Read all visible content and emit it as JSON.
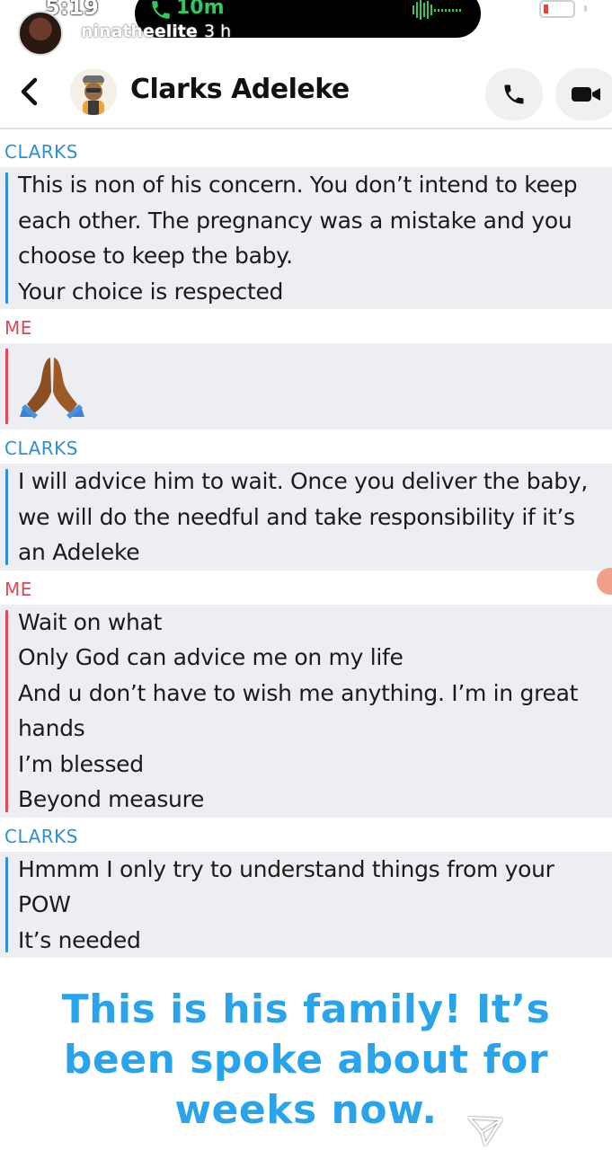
{
  "status_bar": {
    "time": "5:19",
    "call_duration": "10m",
    "call_color": "#34c759"
  },
  "story": {
    "username": "ninatheelite",
    "age": "3 h"
  },
  "chat": {
    "contact_name": "Clarks Adeleke",
    "contact_color": "#2d8fd8",
    "me_color": "#e0485a"
  },
  "messages": [
    {
      "sender": "CLARKS",
      "from": "them",
      "lines": [
        "This is non of his concern. You don’t intend to keep",
        "each other. The pregnancy was a mistake and you",
        "choose to keep the baby.",
        "Your choice is respected"
      ]
    },
    {
      "sender": "ME",
      "from": "me",
      "emoji": "pray-icon"
    },
    {
      "sender": "CLARKS",
      "from": "them",
      "lines": [
        "I will advice him to wait. Once you deliver the baby,",
        "we will do the needful and take responsibility if it’s",
        "an Adeleke"
      ]
    },
    {
      "sender": "ME",
      "from": "me",
      "lines": [
        "Wait on what",
        "Only God can advice me on my life",
        "And u don’t have to wish me anything. I’m in great",
        "hands",
        "I’m blessed",
        "Beyond measure"
      ]
    },
    {
      "sender": "CLARKS",
      "from": "them",
      "lines": [
        "Hmmm I only try to understand things from your",
        "POW",
        "It’s needed"
      ]
    }
  ],
  "caption": {
    "lines": [
      "This is his family! It’s",
      "been spoke about for",
      "weeks now."
    ],
    "color": "#29a4ea"
  }
}
